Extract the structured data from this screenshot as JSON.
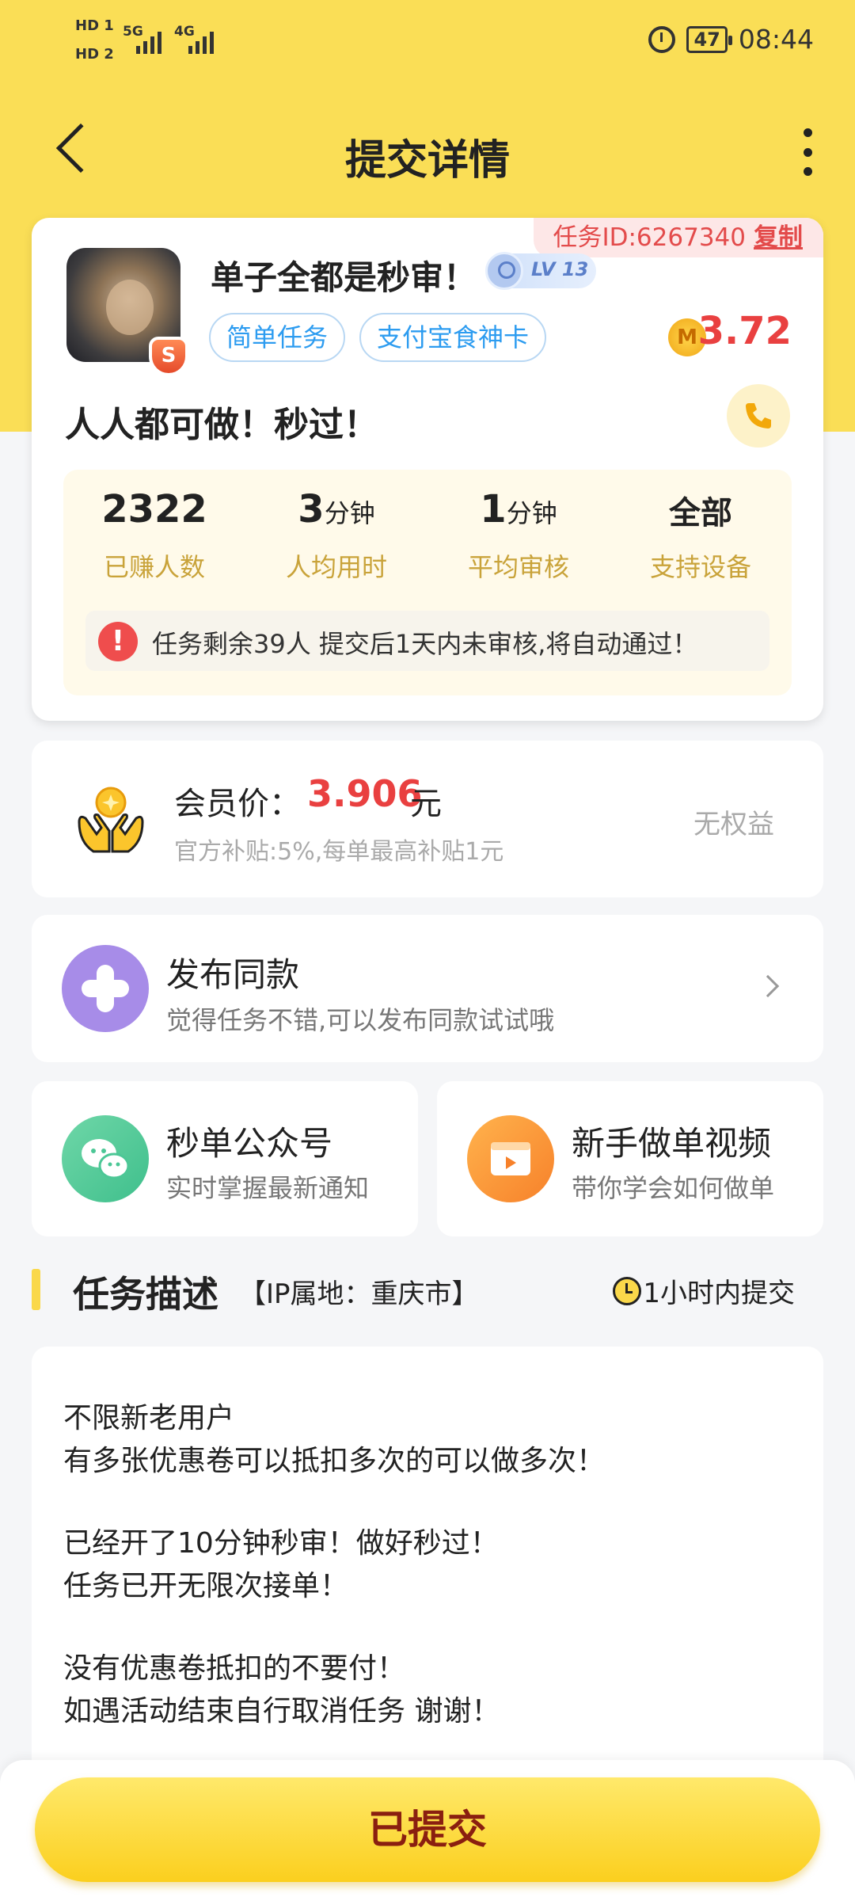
{
  "status_bar": {
    "sim1": "HD 1",
    "sim2": "HD 2",
    "net1": "5G",
    "net2": "4G",
    "battery": "47",
    "time": "08:44"
  },
  "header": {
    "title": "提交详情"
  },
  "task": {
    "id_label": "任务ID:6267340",
    "copy_label": "复制",
    "name": "单子全都是秒审！",
    "level": "LV 13",
    "tags": [
      "简单任务",
      "支付宝食神卡"
    ],
    "price": "3.72",
    "coin_letter": "M",
    "subtitle": "人人都可做！秒过！",
    "stats": [
      {
        "value": "2322",
        "unit": "",
        "label": "已赚人数"
      },
      {
        "value": "3",
        "unit": "分钟",
        "label": "人均用时"
      },
      {
        "value": "1",
        "unit": "分钟",
        "label": "平均审核"
      },
      {
        "value": "全部",
        "unit": "",
        "label": "支持设备"
      }
    ],
    "notice": "任务剩余39人  提交后1天内未审核,将自动通过！"
  },
  "member": {
    "label": "会员价：",
    "price": "3.906",
    "unit": "元",
    "note": "官方补贴:5%,每单最高补贴1元",
    "rights": "无权益"
  },
  "publish": {
    "title": "发布同款",
    "sub": "觉得任务不错,可以发布同款试试哦"
  },
  "shortcuts": [
    {
      "title": "秒单公众号",
      "sub": "实时掌握最新通知"
    },
    {
      "title": "新手做单视频",
      "sub": "带你学会如何做单"
    }
  ],
  "description": {
    "title": "任务描述",
    "ip": "【IP属地：重庆市】",
    "time": "1小时内提交",
    "lines": [
      "不限新老用户",
      "有多张优惠卷可以抵扣多次的可以做多次！",
      "",
      "已经开了10分钟秒审！做好秒过！",
      "任务已开无限次接单！",
      "",
      "没有优惠卷抵扣的不要付！",
      "如遇活动结束自行取消任务 谢谢！"
    ]
  },
  "bottom": {
    "button": "已提交"
  },
  "colors": {
    "header_yellow": "#fade56",
    "price_red": "#e94040",
    "tag_blue": "#2d9cf0",
    "stat_gold": "#c9a33a"
  }
}
